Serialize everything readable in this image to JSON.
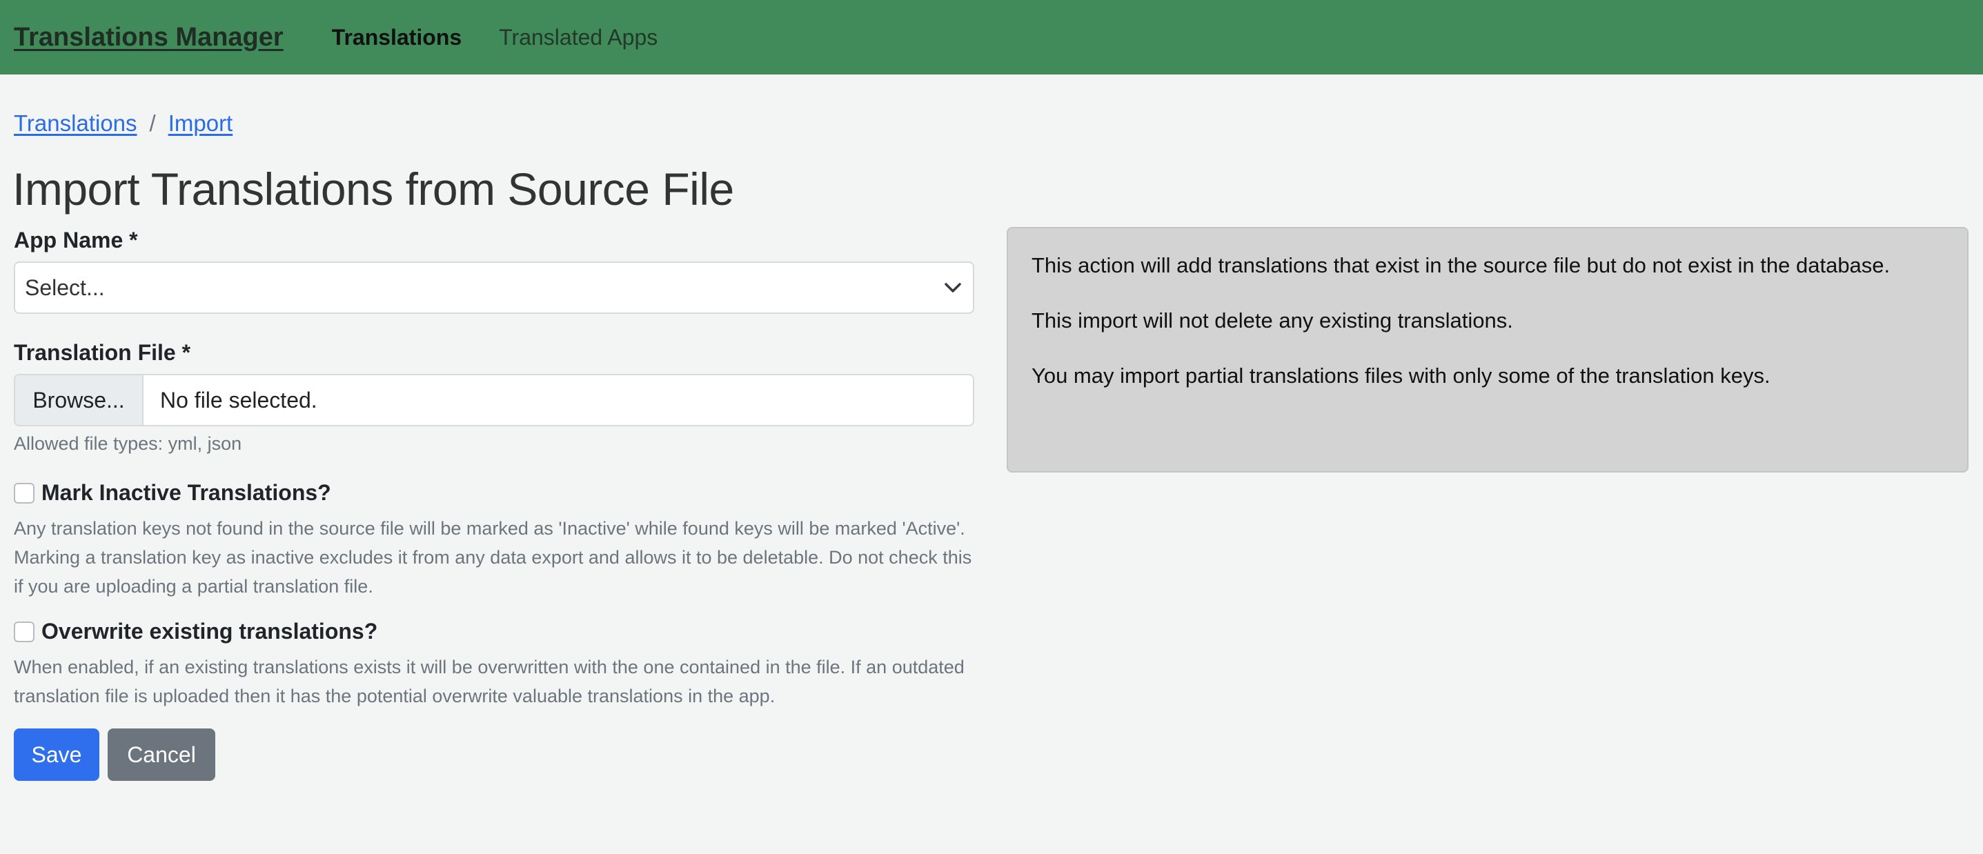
{
  "navbar": {
    "brand": "Translations Manager",
    "links": [
      {
        "label": "Translations",
        "active": true
      },
      {
        "label": "Translated Apps",
        "active": false
      }
    ]
  },
  "breadcrumb": {
    "items": [
      "Translations",
      "Import"
    ],
    "separator": "/"
  },
  "page": {
    "title": "Import Translations from Source File"
  },
  "form": {
    "app_name": {
      "label": "App Name *",
      "selected": "Select..."
    },
    "translation_file": {
      "label": "Translation File *",
      "browse_label": "Browse...",
      "file_status": "No file selected.",
      "help": "Allowed file types: yml, json"
    },
    "mark_inactive": {
      "label": "Mark Inactive Translations?",
      "checked": false,
      "help": "Any translation keys not found in the source file will be marked as 'Inactive' while found keys will be marked 'Active'. Marking a translation key as inactive excludes it from any data export and allows it to be deletable. Do not check this if you are uploading a partial translation file."
    },
    "overwrite": {
      "label": "Overwrite existing translations?",
      "checked": false,
      "help": "When enabled, if an existing translations exists it will be overwritten with the one contained in the file. If an outdated translation file is uploaded then it has the potential overwrite valuable translations in the app."
    },
    "save_label": "Save",
    "cancel_label": "Cancel"
  },
  "info": {
    "paragraphs": [
      "This action will add translations that exist in the source file but do not exist in the database.",
      "This import will not delete any existing translations.",
      "You may import partial translations files with only some of the translation keys."
    ]
  },
  "colors": {
    "navbar_bg": "#418a5a",
    "page_bg": "#f3f5f4",
    "link": "#2a6be6",
    "primary_button": "#2f6fed",
    "secondary_button": "#6c757d",
    "info_bg": "#d3d3d3"
  },
  "icons": {
    "select_caret": "chevron-down-icon"
  }
}
